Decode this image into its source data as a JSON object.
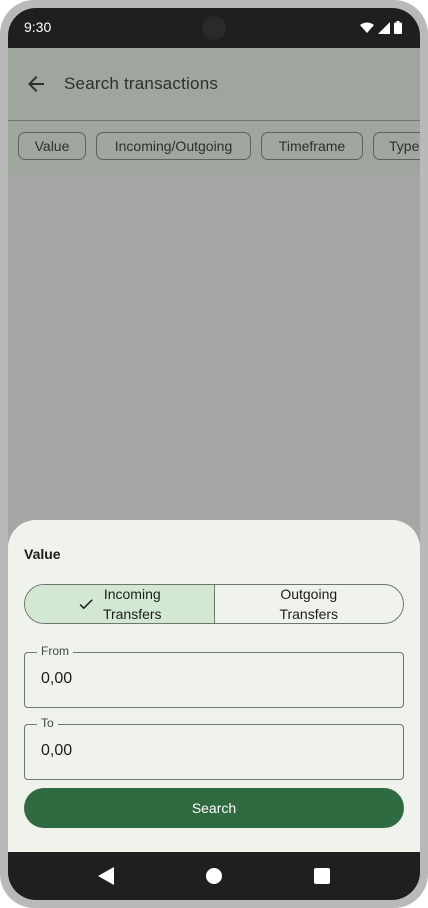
{
  "status_bar": {
    "time": "9:30",
    "icons": [
      "wifi-icon",
      "signal-icon",
      "battery-icon"
    ]
  },
  "app_bar": {
    "back_icon": "arrow-back-icon",
    "title": "Search transactions"
  },
  "filter_chips": [
    {
      "label": "Value"
    },
    {
      "label": "Incoming/Outgoing"
    },
    {
      "label": "Timeframe"
    },
    {
      "label": "Type"
    }
  ],
  "sheet": {
    "title": "Value",
    "segments": [
      {
        "line1": "Incoming",
        "line2": "Transfers",
        "selected": true
      },
      {
        "line1": "Outgoing",
        "line2": "Transfers",
        "selected": false
      }
    ],
    "from": {
      "label": "From",
      "value": "0,00"
    },
    "to": {
      "label": "To",
      "value": "0,00"
    },
    "search_label": "Search"
  },
  "nav_bar": {
    "icons": [
      "back-triangle-icon",
      "home-circle-icon",
      "recents-square-icon"
    ]
  },
  "colors": {
    "primary": "#2f6a40",
    "selected_segment": "#d3e8d2",
    "sheet_bg": "#f0f3ec",
    "scrim": "#a6a6a6"
  }
}
